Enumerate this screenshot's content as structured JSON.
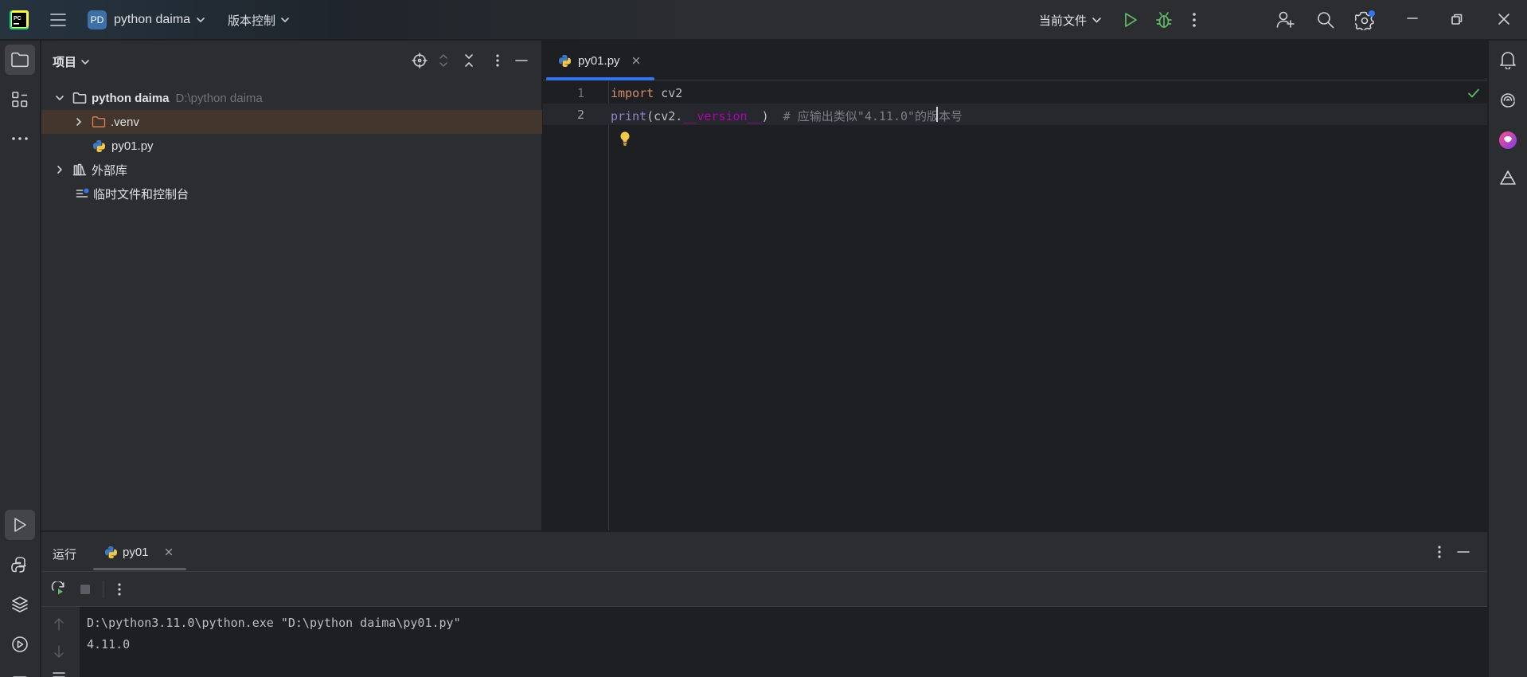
{
  "titlebar": {
    "project_badge": "PD",
    "project_name": "python daima",
    "vcs_label": "版本控制",
    "run_config": "当前文件"
  },
  "project_panel": {
    "title": "项目",
    "tree": [
      {
        "label": "python daima",
        "path": "D:\\python daima"
      },
      {
        "label": ".venv"
      },
      {
        "label": "py01.py"
      },
      {
        "label": "外部库"
      },
      {
        "label": "临时文件和控制台"
      }
    ]
  },
  "editor": {
    "tab_label": "py01.py",
    "lines": [
      {
        "number": "1",
        "kw": "import",
        "rest": " cv2"
      },
      {
        "number": "2",
        "fn": "print",
        "open": "(cv2.",
        "attr": "__version__",
        "close": ")",
        "comment": "  # 应输出类似\"4.11.0\"的版本号"
      }
    ]
  },
  "run_panel": {
    "title": "运行",
    "tab_label": "py01",
    "console": [
      "D:\\python3.11.0\\python.exe \"D:\\python daima\\py01.py\"",
      "4.11.0"
    ]
  },
  "colors": {
    "accent": "#3574f0",
    "keyword": "#cf8e6d",
    "builtin": "#8888c6",
    "magic": "#b200b2",
    "comment": "#7a7e85",
    "run_green": "#5fb865"
  }
}
